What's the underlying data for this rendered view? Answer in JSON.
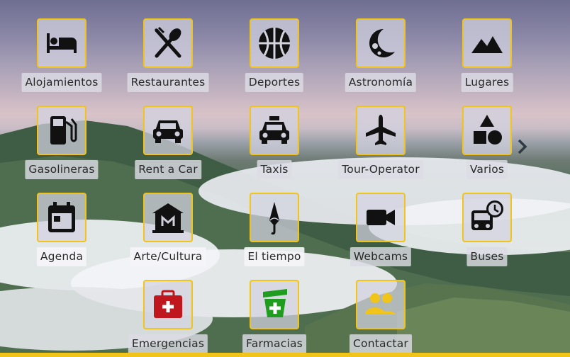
{
  "grid": {
    "items": [
      {
        "label": "Alojamientos",
        "icon": "bed-icon"
      },
      {
        "label": "Restaurantes",
        "icon": "utensils-icon"
      },
      {
        "label": "Deportes",
        "icon": "basketball-icon"
      },
      {
        "label": "Astronomía",
        "icon": "moon-icon"
      },
      {
        "label": "Lugares",
        "icon": "mountain-icon"
      },
      {
        "label": "Gasolineras",
        "icon": "gas-pump-icon"
      },
      {
        "label": "Rent a Car",
        "icon": "car-icon"
      },
      {
        "label": "Taxis",
        "icon": "taxi-icon"
      },
      {
        "label": "Tour-Operator",
        "icon": "plane-icon"
      },
      {
        "label": "Varios",
        "icon": "shapes-icon"
      },
      {
        "label": "Agenda",
        "icon": "calendar-icon"
      },
      {
        "label": "Arte/Cultura",
        "icon": "museum-icon"
      },
      {
        "label": "El tiempo",
        "icon": "umbrella-icon"
      },
      {
        "label": "Webcams",
        "icon": "video-camera-icon"
      },
      {
        "label": "Buses",
        "icon": "bus-clock-icon"
      },
      {
        "label": "Emergencias",
        "icon": "first-aid-kit-icon"
      },
      {
        "label": "Farmacias",
        "icon": "pharmacy-icon"
      },
      {
        "label": "Contactar",
        "icon": "people-icon"
      }
    ]
  },
  "colors": {
    "tile_border": "#f0c419",
    "emergency_red": "#c0161e",
    "pharmacy_green": "#1f9d1f",
    "contact_yellow": "#f0c419"
  },
  "navigation": {
    "next_icon": "chevron-right-icon"
  }
}
